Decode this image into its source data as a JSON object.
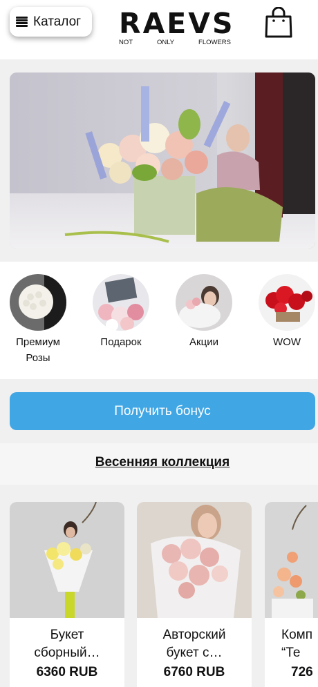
{
  "header": {
    "catalog_label": "Каталог",
    "logo_word": "RAEVS",
    "logo_tagline": [
      "NOT",
      "ONLY",
      "FLOWERS"
    ]
  },
  "categories": [
    {
      "label_line1": "Премиум",
      "label_line2": "Розы"
    },
    {
      "label_line1": "Подарок",
      "label_line2": ""
    },
    {
      "label_line1": "Акции",
      "label_line2": ""
    },
    {
      "label_line1": "WOW",
      "label_line2": ""
    }
  ],
  "bonus": {
    "label": "Получить бонус",
    "color": "#40a6e4"
  },
  "section": {
    "title": "Весенняя коллекция"
  },
  "products": [
    {
      "name_line1": "Букет",
      "name_line2": "сборный…",
      "price": "6360 RUB"
    },
    {
      "name_line1": "Авторский",
      "name_line2": "букет с…",
      "price": "6760 RUB"
    },
    {
      "name_line1": "Комп",
      "name_line2": "“Те",
      "price": "726"
    }
  ]
}
